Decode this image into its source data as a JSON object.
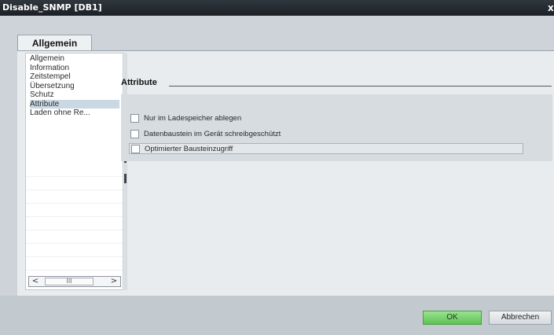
{
  "window": {
    "title": "Disable_SNMP [DB1]",
    "close_glyph": "x"
  },
  "tabs": [
    {
      "label": "Allgemein"
    }
  ],
  "nav": {
    "items": [
      {
        "label": "Allgemein"
      },
      {
        "label": "Information"
      },
      {
        "label": "Zeitstempel"
      },
      {
        "label": "Übersetzung"
      },
      {
        "label": "Schutz"
      },
      {
        "label": "Attribute",
        "selected": true
      },
      {
        "label": "Laden ohne Re..."
      }
    ],
    "scroll_left": "<",
    "scroll_right": ">",
    "scroll_thumb": "III"
  },
  "section": {
    "title": "Attribute",
    "checkboxes": [
      {
        "label": "Nur im Ladespeicher ablegen",
        "checked": false
      },
      {
        "label": "Datenbaustein im Gerät schreibgeschützt",
        "checked": false
      },
      {
        "label": "Optimierter Bausteinzugriff",
        "checked": false
      }
    ]
  },
  "footer": {
    "ok_label": "OK",
    "cancel_label": "Abbrechen"
  },
  "colors": {
    "ok_button": "#6fcb63",
    "titlebar": "#1f252b",
    "selected_item": "#c9d8e3"
  }
}
